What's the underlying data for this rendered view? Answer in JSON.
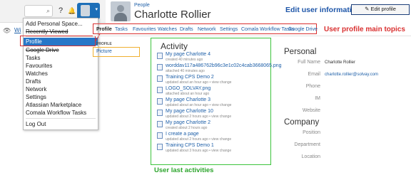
{
  "topbar": {
    "search_label": "⌕",
    "help_icon": "?",
    "bell_icon": "🔔",
    "caret": "▾"
  },
  "left": {
    "eye_icon": "👁",
    "wi_text": "Wi"
  },
  "menu": {
    "items": [
      "Add Personal Space...",
      "Recently Viewed",
      "Profile",
      "Google Drive",
      "Tasks",
      "Favourites",
      "Watches",
      "Drafts",
      "Network",
      "Settings",
      "Atlassian Marketplace",
      "Comala Workflow Tasks",
      "Log Out"
    ]
  },
  "profile": {
    "breadcrumb": "People",
    "name": "Charlotte Rollier",
    "edit_button": "✎ Edit profile"
  },
  "tabs": [
    "Profile",
    "Tasks",
    "Favourites",
    "Watches",
    "Drafts",
    "Network",
    "Settings",
    "Comala Workflow Tasks",
    "Google Drive"
  ],
  "sidebar": {
    "label": "PROFILE",
    "picture": "Picture"
  },
  "activity": {
    "title": "Activity",
    "items": [
      {
        "title": "My page Charlotte 4",
        "meta": "created 40 minutes ago"
      },
      {
        "title": "worddav117a486762b96c3e1c02c4cab3668065.png",
        "meta": "attached 40 minutes ago"
      },
      {
        "title": "Training CPS Demo 2",
        "meta": "updated about an hour ago • view change"
      },
      {
        "title": "LOGO_SOLVAY.png",
        "meta": "attached about an hour ago"
      },
      {
        "title": "My page Charlotte 3",
        "meta": "updated about an hour ago • view change"
      },
      {
        "title": "My page Charlotte 10",
        "meta": "updated about 2 hours ago • view change"
      },
      {
        "title": "My page Charlotte 2",
        "meta": "created about 2 hours ago"
      },
      {
        "title": "I create a page",
        "meta": "updated about 2 hours ago • view change"
      },
      {
        "title": "Training CPS Demo 1",
        "meta": "updated about 3 hours ago • view change"
      }
    ]
  },
  "personal": {
    "title": "Personal",
    "full_name_label": "Full Name",
    "full_name": "Charlotte Rollier",
    "email_label": "Email",
    "email": "charlotte.rollier@solvay.com",
    "phone_label": "Phone",
    "im_label": "IM",
    "website_label": "Website"
  },
  "company": {
    "title": "Company",
    "position_label": "Position",
    "department_label": "Department",
    "location_label": "Location"
  },
  "annotations": {
    "edit": "Edit user information",
    "topics": "User profile main topics",
    "activities": "User last activities"
  },
  "colors": {
    "link": "#1d5fa8",
    "menu_active": "#2777c8",
    "red_annotation": "#d93030",
    "green_annotation": "#2da52d",
    "blue_annotation": "#1d55a8"
  }
}
